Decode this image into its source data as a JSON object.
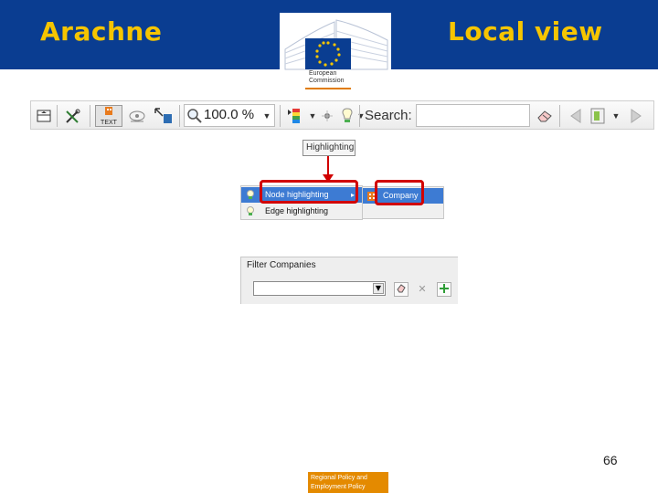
{
  "header": {
    "title_left": "Arachne",
    "title_right": "Local view",
    "logo_text_line1": "European",
    "logo_text_line2": "Commission"
  },
  "toolbar": {
    "text_button_label": "TEXT",
    "zoom_value": "100.0 %",
    "search_label": "Search:",
    "search_value": ""
  },
  "tooltip": {
    "label": "Highlighting"
  },
  "menu": {
    "items": [
      {
        "label": "Node highlighting",
        "selected": true
      },
      {
        "label": "Edge highlighting",
        "selected": false
      }
    ],
    "submenu_item": "Company"
  },
  "filter": {
    "title": "Filter Companies",
    "selected_value": ""
  },
  "slide": {
    "page_number": "66",
    "footer_line1": "Regional Policy and",
    "footer_line2": "Employment Policy"
  },
  "colors": {
    "banner": "#0a3d91",
    "title": "#f6c500",
    "highlight_red": "#d10000",
    "menu_selected": "#3d7bd3",
    "footer_orange": "#e48a00"
  }
}
